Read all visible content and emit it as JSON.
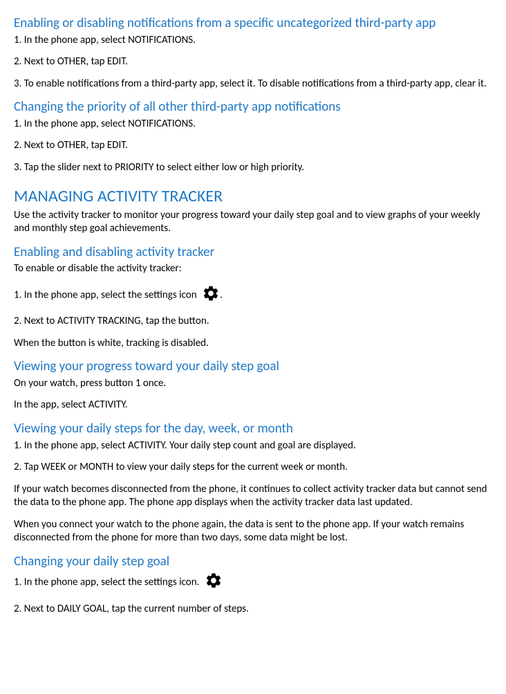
{
  "sections": {
    "s1": {
      "heading": "Enabling or disabling notifications from a specific uncategorized third-party app",
      "step1": "1. In the phone app, select NOTIFICATIONS.",
      "step2": "2. Next to OTHER, tap EDIT.",
      "step3": "3. To enable notifications from a third-party app, select it. To disable notifications from a third-party app, clear it."
    },
    "s2": {
      "heading": "Changing the priority of all other third-party app notifications",
      "step1": "1. In the phone app, select NOTIFICATIONS.",
      "step2": "2. Next to OTHER, tap EDIT.",
      "step3": "3. Tap the slider next to PRIORITY to select either low or high priority."
    },
    "s3": {
      "heading": "MANAGING ACTIVITY TRACKER",
      "intro": "Use the activity tracker to monitor your progress toward your daily step goal and to view graphs of your weekly and monthly step goal achievements."
    },
    "s4": {
      "heading": "Enabling and disabling activity tracker",
      "intro": "To enable or disable the activity tracker:",
      "step1_prefix": "1. In the phone app, select the settings icon ",
      "step1_suffix": ".",
      "step2": "2. Next to ACTIVITY TRACKING, tap the button.",
      "note": "When the button is white, tracking is disabled."
    },
    "s5": {
      "heading": "Viewing your progress toward your daily step goal",
      "p1": "On your watch, press button 1 once.",
      "p2": "In the app, select ACTIVITY."
    },
    "s6": {
      "heading": "Viewing your daily steps for the day, week, or month",
      "step1": "1. In the phone app, select ACTIVITY. Your daily step count and goal are displayed.",
      "step2": "2. Tap WEEK or MONTH to view your daily steps for the current week or month.",
      "p1": "If your watch becomes disconnected from the phone, it continues to collect activity tracker data but cannot send the data to the phone app. The phone app displays when the activity tracker data last updated.",
      "p2": "When you connect your watch to the phone again, the data is sent to the phone app. If your watch remains disconnected from the phone for more than two days, some data might be lost."
    },
    "s7": {
      "heading": "Changing your daily step goal",
      "step1_prefix": "1. In the phone app, select the settings icon. ",
      "step2": "2. Next to DAILY GOAL, tap the current number of steps."
    }
  }
}
